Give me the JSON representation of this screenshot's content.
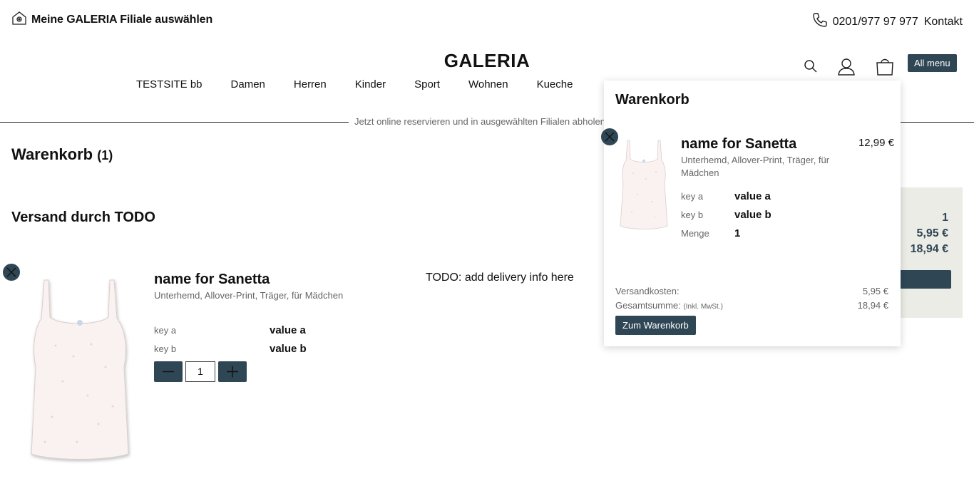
{
  "header": {
    "store_picker": "Meine GALERIA Filiale auswählen",
    "phone": "0201/977 97 977",
    "contact": "Kontakt",
    "logo": "GALERIA",
    "all_menu": "All menu"
  },
  "nav": [
    "TESTSITE bb",
    "Damen",
    "Herren",
    "Kinder",
    "Sport",
    "Wohnen",
    "Kueche"
  ],
  "promo": "Jetzt online reservieren und in ausgewählten Filialen abholen",
  "cart": {
    "title": "Warenkorb",
    "count": "(1)",
    "shipping_group": "Versand durch TODO",
    "delivery_info": "TODO: add delivery info here",
    "item": {
      "name": "name for Sanetta",
      "description": "Unterhemd, Allover-Print, Träger, für Mädchen",
      "attrs": [
        {
          "key": "key a",
          "value": "value a"
        },
        {
          "key": "key b",
          "value": "value b"
        }
      ],
      "quantity": "1"
    },
    "summary": {
      "items": "1",
      "shipping": "5,95 €",
      "total": "18,94 €"
    }
  },
  "flyout": {
    "title": "Warenkorb",
    "item": {
      "name": "name for Sanetta",
      "price": "12,99 €",
      "description": "Unterhemd, Allover-Print, Träger, für Mädchen",
      "attrs": [
        {
          "key": "key a",
          "value": "value a"
        },
        {
          "key": "key b",
          "value": "value b"
        },
        {
          "key": "Menge",
          "value": "1"
        }
      ]
    },
    "shipping_label": "Versandkosten:",
    "shipping_value": "5,95 €",
    "total_label": "Gesamtsumme:",
    "total_note": "(Inkl. MwSt.)",
    "total_value": "18,94 €",
    "to_cart_button": "Zum Warenkorb"
  },
  "colors": {
    "accent": "#2f4655",
    "summary_bg": "#ecece6"
  }
}
